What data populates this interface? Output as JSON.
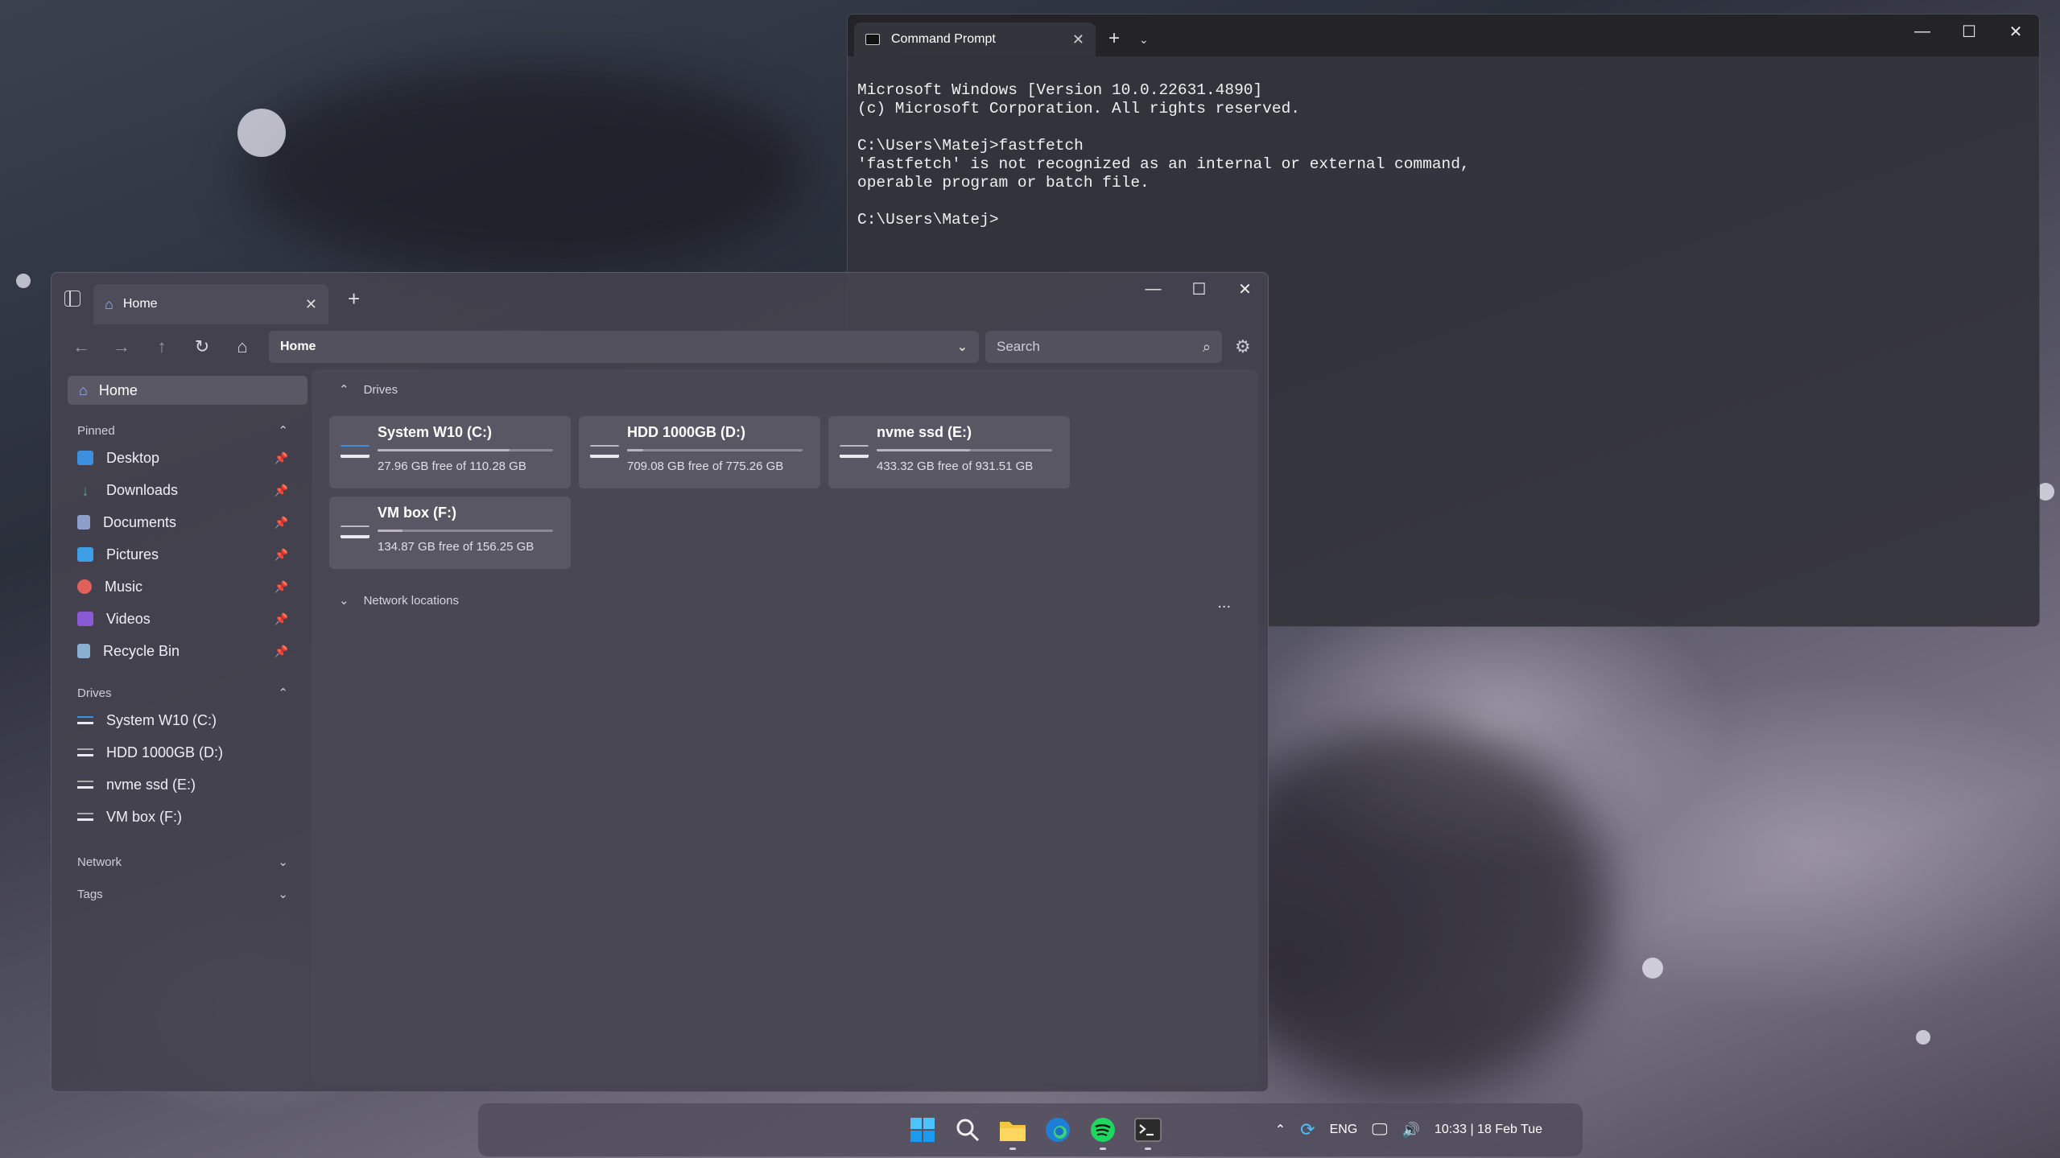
{
  "command_prompt": {
    "tab_title": "Command Prompt",
    "new_tab": "+",
    "dropdown": "⌄",
    "controls": {
      "minimize": "—",
      "maximize": "☐",
      "close": "✕"
    },
    "lines": [
      "Microsoft Windows [Version 10.0.22631.4890]",
      "(c) Microsoft Corporation. All rights reserved.",
      "",
      "C:\\Users\\Matej>fastfetch",
      "'fastfetch' is not recognized as an internal or external command,",
      "operable program or batch file.",
      "",
      "C:\\Users\\Matej>"
    ]
  },
  "explorer": {
    "tab_title": "Home",
    "new_tab": "+",
    "controls": {
      "minimize": "—",
      "maximize": "☐",
      "close": "✕"
    },
    "address": "Home",
    "search_placeholder": "Search",
    "sidebar": {
      "home": "Home",
      "pinned_header": "Pinned",
      "pinned": [
        {
          "label": "Desktop",
          "icon": "desktop-icon",
          "color": "#3d8fe0"
        },
        {
          "label": "Downloads",
          "icon": "downloads-icon",
          "color": "#3fb37a"
        },
        {
          "label": "Documents",
          "icon": "documents-icon",
          "color": "#8c9fc8"
        },
        {
          "label": "Pictures",
          "icon": "pictures-icon",
          "color": "#3da0e6"
        },
        {
          "label": "Music",
          "icon": "music-icon",
          "color": "#e0605a"
        },
        {
          "label": "Videos",
          "icon": "videos-icon",
          "color": "#8a5ad6"
        },
        {
          "label": "Recycle Bin",
          "icon": "recycle-bin-icon",
          "color": "#8ab0d0"
        }
      ],
      "drives_header": "Drives",
      "drives": [
        "System W10 (C:)",
        "HDD 1000GB (D:)",
        "nvme ssd (E:)",
        "VM box (F:)"
      ],
      "network": "Network",
      "tags": "Tags"
    },
    "content": {
      "drives_header": "Drives",
      "drives": [
        {
          "name": "System W10 (C:)",
          "free": "27.96 GB free of 110.28 GB",
          "used_fraction": 0.75
        },
        {
          "name": "HDD 1000GB (D:)",
          "free": "709.08 GB free of 775.26 GB",
          "used_fraction": 0.09
        },
        {
          "name": "nvme ssd (E:)",
          "free": "433.32 GB free of 931.51 GB",
          "used_fraction": 0.53
        },
        {
          "name": "VM box (F:)",
          "free": "134.87 GB free of 156.25 GB",
          "used_fraction": 0.14
        }
      ],
      "network_header": "Network locations",
      "more": "..."
    }
  },
  "taskbar": {
    "tray": {
      "lang": "ENG",
      "clock": "10:33 | 18 Feb Tue"
    }
  }
}
